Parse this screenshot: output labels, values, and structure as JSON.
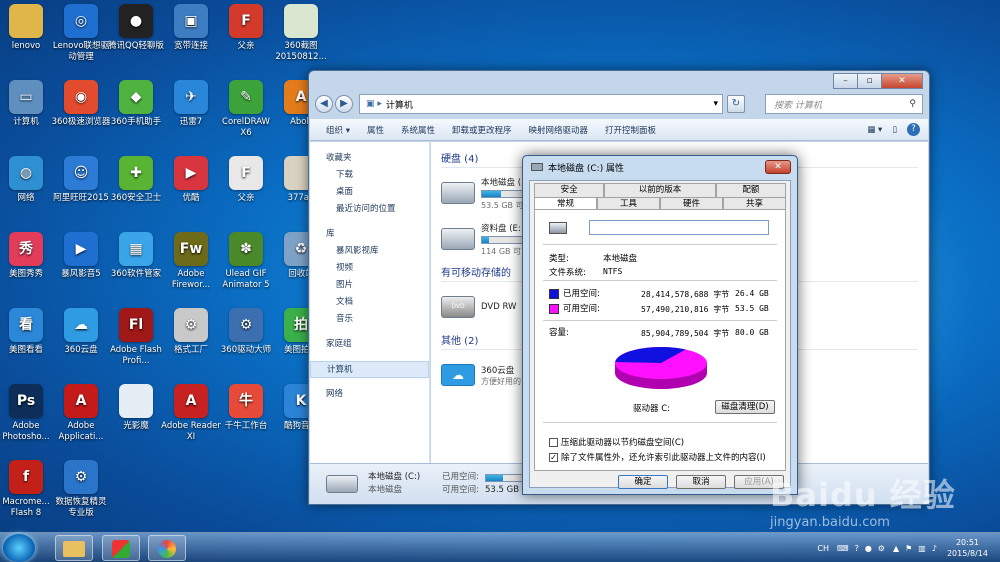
{
  "desktop": {
    "icons": [
      {
        "label": "lenovo",
        "color": "#e0b64a",
        "glyph": ""
      },
      {
        "label": "Lenovo联想驱动管理",
        "color": "#1f6fd1",
        "glyph": "◎"
      },
      {
        "label": "腾讯QQ轻聊版",
        "color": "#222",
        "glyph": "●"
      },
      {
        "label": "宽带连接",
        "color": "#3d7ec2",
        "glyph": "▣"
      },
      {
        "label": "父亲",
        "color": "#d43a2a",
        "glyph": "F"
      },
      {
        "label": "360截图20150812...",
        "color": "#d9e6d0",
        "glyph": ""
      },
      {
        "label": "计算机",
        "color": "#5e8fbf",
        "glyph": "▭"
      },
      {
        "label": "360极速浏览器",
        "color": "#e34b2e",
        "glyph": "◉"
      },
      {
        "label": "360手机助手",
        "color": "#4fb33f",
        "glyph": "◆"
      },
      {
        "label": "迅雷7",
        "color": "#2a86d9",
        "glyph": "✈"
      },
      {
        "label": "CorelDRAW X6",
        "color": "#3ca33a",
        "glyph": "✎"
      },
      {
        "label": "Abob",
        "color": "#e57c1c",
        "glyph": "A"
      },
      {
        "label": "网络",
        "color": "#2e8fd1",
        "glyph": "◍"
      },
      {
        "label": "阿里旺旺2015",
        "color": "#2c7bd6",
        "glyph": "☺"
      },
      {
        "label": "360安全卫士",
        "color": "#58b432",
        "glyph": "✚"
      },
      {
        "label": "优酷",
        "color": "#d8353f",
        "glyph": "▶"
      },
      {
        "label": "父亲",
        "color": "#e8e8e8",
        "glyph": "F"
      },
      {
        "label": "377ad",
        "color": "#d9d2c0",
        "glyph": ""
      },
      {
        "label": "美图秀秀",
        "color": "#e33c5a",
        "glyph": "秀"
      },
      {
        "label": "暴风影音5",
        "color": "#1e6fd0",
        "glyph": "▶"
      },
      {
        "label": "360软件管家",
        "color": "#3aa5e8",
        "glyph": "▦"
      },
      {
        "label": "Adobe Firewor...",
        "color": "#6d6a1a",
        "glyph": "Fw"
      },
      {
        "label": "Ulead GIF Animator 5",
        "color": "#4a8a2a",
        "glyph": "✽"
      },
      {
        "label": "回收站",
        "color": "#7ea2c7",
        "glyph": "♻"
      },
      {
        "label": "美图看看",
        "color": "#2b88d8",
        "glyph": "看"
      },
      {
        "label": "360云盘",
        "color": "#2f9be3",
        "glyph": "☁"
      },
      {
        "label": "Adobe Flash Profi...",
        "color": "#a01818",
        "glyph": "Fl"
      },
      {
        "label": "格式工厂",
        "color": "#c9c9c9",
        "glyph": "⚙"
      },
      {
        "label": "360驱动大师",
        "color": "#3c6fb0",
        "glyph": "⚙"
      },
      {
        "label": "美图拍拍",
        "color": "#3bb04a",
        "glyph": "拍"
      },
      {
        "label": "Adobe Photosho...",
        "color": "#0c2e58",
        "glyph": "Ps"
      },
      {
        "label": "Adobe Applicati...",
        "color": "#c41a1a",
        "glyph": "A"
      },
      {
        "label": "光影魔",
        "color": "#e5edf5",
        "glyph": ""
      },
      {
        "label": "Adobe Reader XI",
        "color": "#c82121",
        "glyph": "A"
      },
      {
        "label": "千牛工作台",
        "color": "#e84a3a",
        "glyph": "牛"
      },
      {
        "label": "酷狗音乐",
        "color": "#2b84d8",
        "glyph": "K"
      },
      {
        "label": "Macrome... Flash 8",
        "color": "#c4201a",
        "glyph": "f"
      },
      {
        "label": "数据恢复精灵 专业版",
        "color": "#2a75c9",
        "glyph": "⚙"
      }
    ]
  },
  "explorer": {
    "address": "计算机",
    "search_placeholder": "搜索 计算机",
    "toolbar": [
      "组织 ▾",
      "属性",
      "系统属性",
      "卸载或更改程序",
      "映射网络驱动器",
      "打开控制面板"
    ],
    "nav": [
      {
        "label": "收藏夹",
        "sub": false
      },
      {
        "label": "下载",
        "sub": true
      },
      {
        "label": "桌面",
        "sub": true
      },
      {
        "label": "最近访问的位置",
        "sub": true
      },
      {
        "label": "",
        "sub": false
      },
      {
        "label": "库",
        "sub": false
      },
      {
        "label": "暴风影视库",
        "sub": true
      },
      {
        "label": "视频",
        "sub": true
      },
      {
        "label": "图片",
        "sub": true
      },
      {
        "label": "文档",
        "sub": true
      },
      {
        "label": "音乐",
        "sub": true
      },
      {
        "label": "",
        "sub": false
      },
      {
        "label": "家庭组",
        "sub": false
      },
      {
        "label": "",
        "sub": false
      },
      {
        "label": "计算机",
        "sub": false
      },
      {
        "label": "",
        "sub": false
      },
      {
        "label": "网络",
        "sub": false
      }
    ],
    "groups": {
      "hdd": "硬盘 (4)",
      "removable": "有可移动存储的",
      "other": "其他 (2)"
    },
    "drives": [
      {
        "name": "本地磁盘 (",
        "fill": 0.33,
        "size": "53.5 GB 可"
      },
      {
        "name": "资料盘 (E:",
        "fill": 0.12,
        "size": "114 GB 可"
      }
    ],
    "dvd": "DVD RW",
    "cloud": {
      "name": "360云盘",
      "desc": "方便好用的"
    },
    "status": {
      "name": "本地磁盘 (C:)",
      "type": "本地磁盘",
      "used_label": "已用空间:",
      "free_label": "可用空间:",
      "free": "53.5 GB",
      "fill": 0.33
    }
  },
  "dialog": {
    "title": "本地磁盘 (C:) 属性",
    "tabs_top": [
      "安全",
      "以前的版本",
      "配额"
    ],
    "tabs_bottom": [
      "常规",
      "工具",
      "硬件",
      "共享"
    ],
    "type_label": "类型:",
    "type_value": "本地磁盘",
    "fs_label": "文件系统:",
    "fs_value": "NTFS",
    "used": {
      "label": "已用空间:",
      "bytes": "28,414,578,688 字节",
      "size": "26.4 GB",
      "color": "#1010e0"
    },
    "free": {
      "label": "可用空间:",
      "bytes": "57,490,210,816 字节",
      "size": "53.5 GB",
      "color": "#ff10ff"
    },
    "capacity": {
      "label": "容量:",
      "bytes": "85,904,789,504 字节",
      "size": "80.0 GB"
    },
    "pie": {
      "used_fraction": 0.33
    },
    "drive_label": "驱动器 C:",
    "cleanup": "磁盘清理(D)",
    "compress": "压缩此驱动器以节约磁盘空间(C)",
    "index": "除了文件属性外，还允许索引此驱动器上文件的内容(I)",
    "ok": "确定",
    "cancel": "取消",
    "apply": "应用(A)"
  },
  "taskbar": {
    "lang": "CH",
    "time": "20:51",
    "date": "2015/8/14"
  },
  "watermark": {
    "brand": "Baidu 经验",
    "url": "jingyan.baidu.com"
  }
}
